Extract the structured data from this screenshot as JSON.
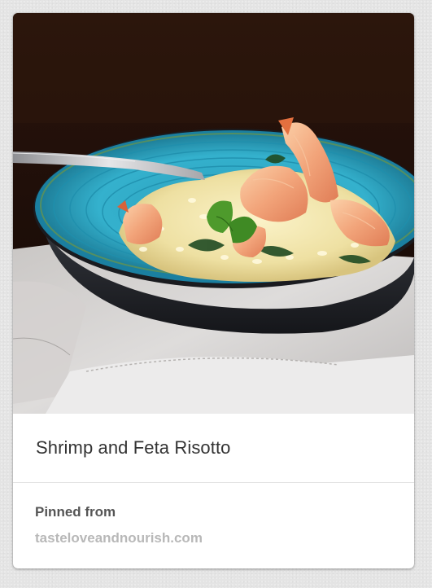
{
  "pin": {
    "image_alt": "Shrimp and feta risotto in a turquoise bowl",
    "description": "Shrimp and Feta Risotto",
    "pinned_from_label": "Pinned from",
    "source": "tasteloveandnourish.com"
  }
}
